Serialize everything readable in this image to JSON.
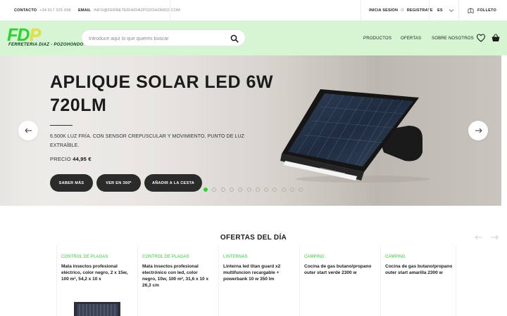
{
  "topbar": {
    "contact_label": "CONTACTO",
    "contact_value": "+34 617 325 098",
    "email_label": "EMAIL",
    "email_value": "INFO@FERRETERIADIAZPOZOHONDO.COM",
    "login": "INICIA SESION",
    "or": "O",
    "register": "REGISTRATE",
    "language": "ES",
    "brochure": "FOLLETO"
  },
  "header": {
    "logo_text": "FDP",
    "logo_subtitle": "FERRETERIA DIAZ - POZOHONDO",
    "search_placeholder": "Introduce aquí lo que quieres buscar",
    "nav": [
      "PRODUCTOS",
      "OFERTAS",
      "SOBRE NOSOTROS"
    ]
  },
  "hero": {
    "title": "APLIQUE SOLAR LED 6W 720LM",
    "description": "6.500K LUZ FRÍA. CON SENSOR CREPUSCULAR Y MOVIMIENTO. PUNTO DE LUZ EXTRAÍBLE.",
    "price_label": "PRECIO",
    "price_value": "44,95 €",
    "buttons": [
      "SABER MÁS",
      "VER EN 360º",
      "AÑADIR A LA CESTA"
    ],
    "slide_count": 12,
    "active_slide": 1
  },
  "offers": {
    "title": "OFERTAS DEL DÍA",
    "cards": [
      {
        "category": "CONTROL DE PLAGAS",
        "name": "Mata insectos profesional eléctrico, color negro, 2 x 15w, 100 m², 54,2 x 10 x"
      },
      {
        "category": "CONTROL DE PLAGAS",
        "name": "Mata insectos profesional electrónico con led, color negro, 10w, 100 m², 31,6 x 10 x 26,3 cm"
      },
      {
        "category": "LINTERNAS",
        "name": "Linterna led titan guard x2 multifuncion recargable + powerbank 10 w 350 lm"
      },
      {
        "category": "CAMPING",
        "name": "Cocina de gas butano/propano outer start verde 2300 w"
      },
      {
        "category": "CAMPING",
        "name": "Cocina de gas butano/propano outer start amarilla 2300 w"
      }
    ]
  },
  "colors": {
    "accent_green": "#2fd133",
    "header_bg": "#d6f5d3",
    "button_dark": "#2b2b2b"
  }
}
